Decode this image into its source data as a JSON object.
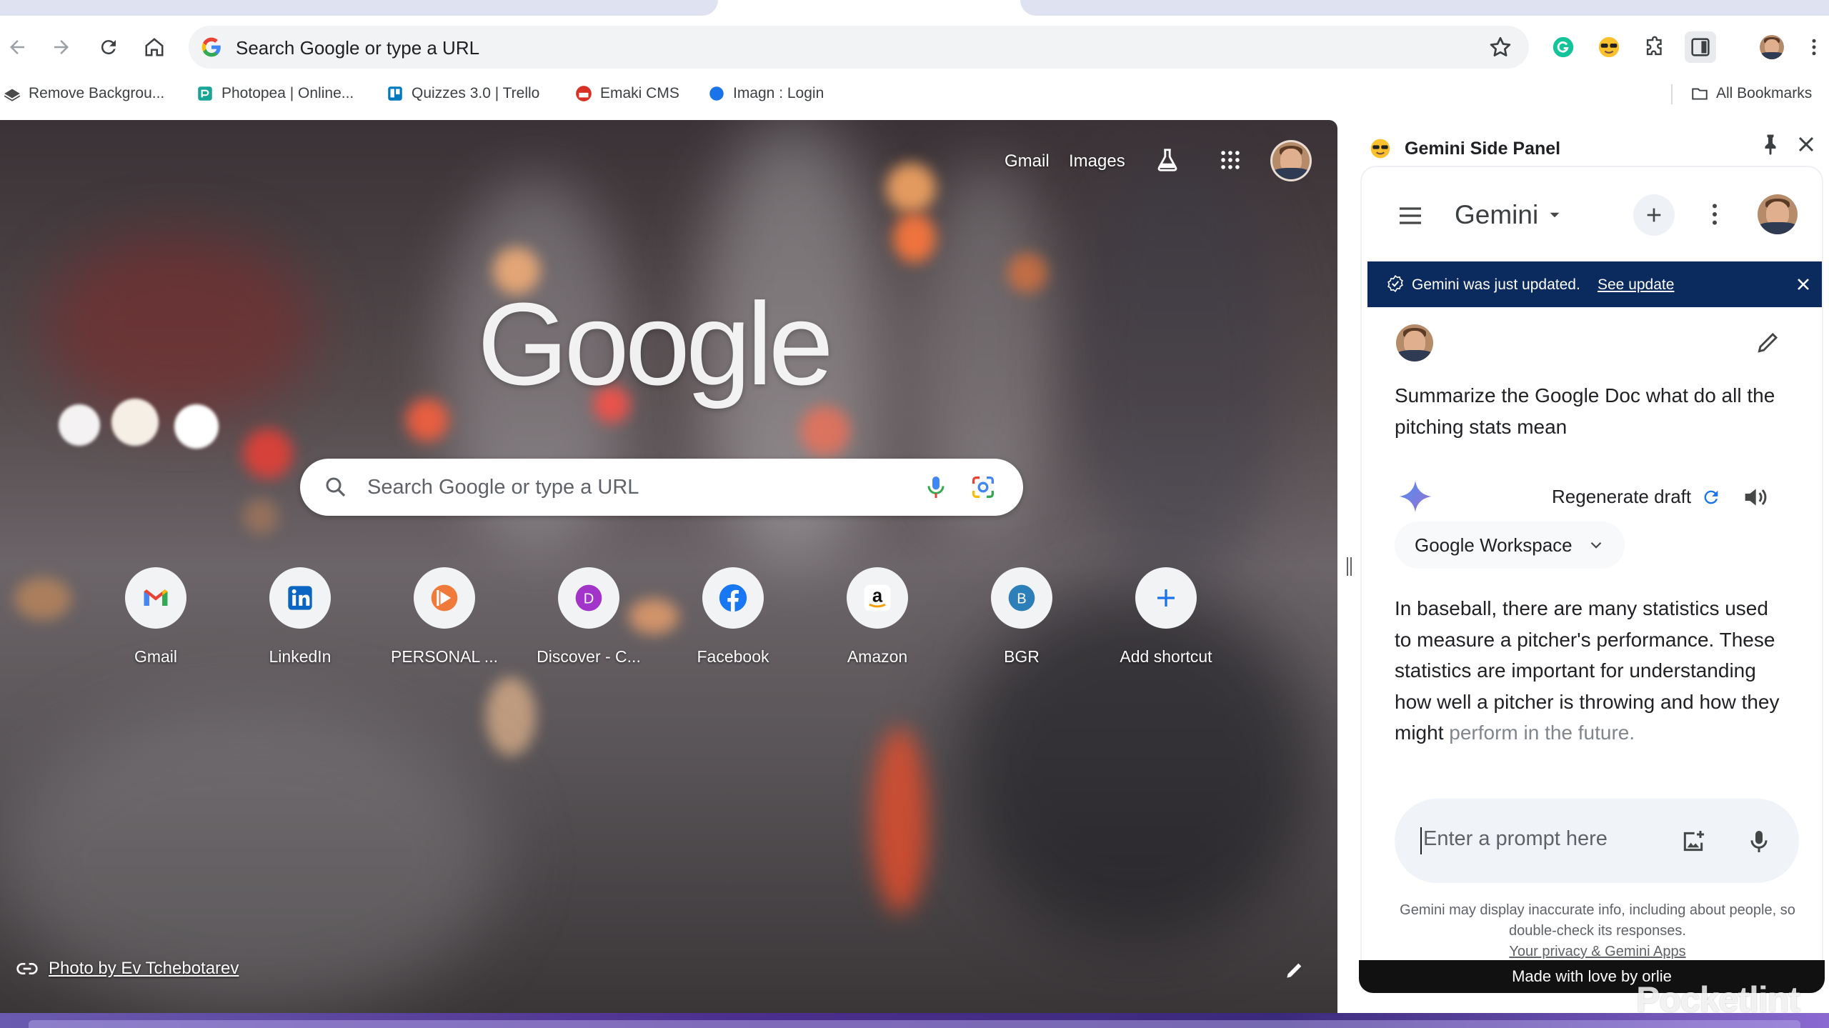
{
  "toolbar": {
    "omnibox_text": "Search Google or type a URL"
  },
  "bookmarks": [
    {
      "label": "Remove Backgrou...",
      "icon": "remove-bg-icon",
      "color": "#4a4a4a"
    },
    {
      "label": "Photopea | Online...",
      "icon": "photopea-icon",
      "color": "#18a497"
    },
    {
      "label": "Quizzes 3.0 | Trello",
      "icon": "trello-icon",
      "color": "#0079bf"
    },
    {
      "label": "Emaki CMS",
      "icon": "emaki-icon",
      "color": "#d93025"
    },
    {
      "label": "Imagn : Login",
      "icon": "imagn-icon",
      "color": "#1a73e8"
    }
  ],
  "all_bookmarks": "All Bookmarks",
  "ntp": {
    "links": {
      "gmail": "Gmail",
      "images": "Images"
    },
    "logo_text": "Google",
    "search_placeholder": "Search Google or type a URL",
    "shortcuts": [
      {
        "label": "Gmail",
        "icon": "gmail-icon"
      },
      {
        "label": "LinkedIn",
        "icon": "linkedin-icon",
        "color": "#0a66c2"
      },
      {
        "label": "PERSONAL ...",
        "icon": "personal-icon",
        "color": "#f07a3a"
      },
      {
        "label": "Discover - C...",
        "icon": "discover-icon",
        "letter": "D",
        "color": "#a334c9"
      },
      {
        "label": "Facebook",
        "icon": "facebook-icon",
        "color": "#1877f2"
      },
      {
        "label": "Amazon",
        "icon": "amazon-icon"
      },
      {
        "label": "BGR",
        "icon": "bgr-icon",
        "letter": "B",
        "color": "#2c7fb8"
      },
      {
        "label": "Add shortcut",
        "icon": "plus-icon"
      }
    ],
    "photo_credit": "Photo by Ev Tchebotarev"
  },
  "side_panel": {
    "title": "Gemini Side Panel",
    "gemini": {
      "title": "Gemini",
      "banner_text": "Gemini was just updated.",
      "banner_link": "See update",
      "user_prompt": "Summarize the Google Doc what do all the pitching stats mean",
      "regenerate_label": "Regenerate draft",
      "workspace_chip": "Google Workspace",
      "response_text": "In baseball, there are many statistics used to measure a pitcher's performance. These statistics are important for understanding how well a pitcher is throwing and how they might",
      "response_fade": "perform in the future.",
      "prompt_placeholder": "Enter a prompt here",
      "disclaimer": "Gemini may display inaccurate info, including about people, so double-check its responses.",
      "privacy_link": "Your privacy & Gemini Apps"
    },
    "made_with": "Made with love by orlie"
  },
  "watermark": "Pocketlint",
  "colors": {
    "gemini_banner": "#0b2a5e",
    "accent_blue": "#1a73e8"
  }
}
